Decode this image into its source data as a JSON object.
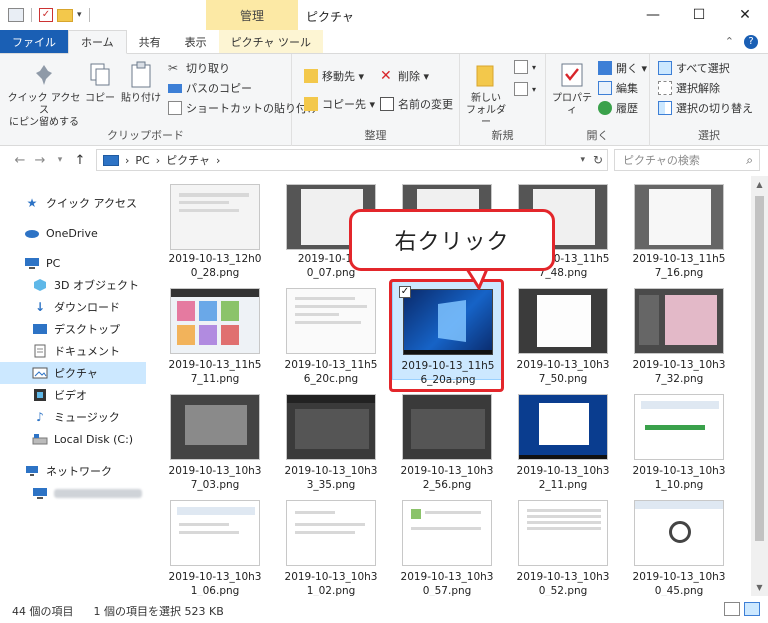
{
  "titlebar": {
    "manage_tab": "管理",
    "window_title": "ピクチャ",
    "minimize": "—",
    "maximize": "☐",
    "close": "✕"
  },
  "tabs": {
    "file": "ファイル",
    "home": "ホーム",
    "share": "共有",
    "view": "表示",
    "picture_tools": "ピクチャ ツール"
  },
  "ribbon": {
    "clipboard": {
      "label": "クリップボード",
      "pin_quick_access": "クイック アクセス\nにピン留めする",
      "pin_line1": "クイック アクセス",
      "pin_line2": "にピン留めする",
      "copy": "コピー",
      "paste": "貼り付け",
      "cut": "切り取り",
      "copy_path": "パスのコピー",
      "paste_shortcut": "ショートカットの貼り付け"
    },
    "organize": {
      "label": "整理",
      "move_to": "移動先 ▾",
      "copy_to": "コピー先 ▾",
      "delete": "削除 ▾",
      "rename": "名前の変更"
    },
    "new": {
      "label": "新規",
      "new_folder_line1": "新しい",
      "new_folder_line2": "フォルダー"
    },
    "open": {
      "label": "開く",
      "properties": "プロパティ",
      "open": "開く ▾",
      "edit": "編集",
      "history": "履歴"
    },
    "select": {
      "label": "選択",
      "select_all": "すべて選択",
      "select_none": "選択解除",
      "invert": "選択の切り替え"
    }
  },
  "address": {
    "path": [
      "PC",
      "ピクチャ"
    ],
    "separator": "›",
    "search_placeholder": "ピクチャの検索"
  },
  "nav": {
    "items": [
      {
        "label": "クイック アクセス",
        "icon": "star-icon"
      },
      {
        "label": "OneDrive",
        "icon": "cloud-icon"
      },
      {
        "label": "PC",
        "icon": "computer-icon"
      },
      {
        "label": "3D オブジェクト",
        "icon": "cube-icon"
      },
      {
        "label": "ダウンロード",
        "icon": "download-icon"
      },
      {
        "label": "デスクトップ",
        "icon": "desktop-icon"
      },
      {
        "label": "ドキュメント",
        "icon": "document-icon"
      },
      {
        "label": "ピクチャ",
        "icon": "picture-icon"
      },
      {
        "label": "ビデオ",
        "icon": "video-icon"
      },
      {
        "label": "ミュージック",
        "icon": "music-icon"
      },
      {
        "label": "Local Disk (C:)",
        "icon": "disk-icon"
      },
      {
        "label": "ネットワーク",
        "icon": "network-icon"
      }
    ]
  },
  "files": [
    {
      "line1": "2019-10-13_12h0",
      "line2": "0_28.png"
    },
    {
      "line1": "2019-10-13_",
      "line2": "0_07.png"
    },
    {
      "line1": "",
      "line2": ""
    },
    {
      "line1": "2019-10-13_11h5",
      "line2": "7_48.png"
    },
    {
      "line1": "2019-10-13_11h5",
      "line2": "7_16.png"
    },
    {
      "line1": "2019-10-13_11h5",
      "line2": "7_11.png"
    },
    {
      "line1": "2019-10-13_11h5",
      "line2": "6_20c.png"
    },
    {
      "line1": "2019-10-13_11h5",
      "line2": "6_20a.png"
    },
    {
      "line1": "2019-10-13_10h3",
      "line2": "7_50.png"
    },
    {
      "line1": "2019-10-13_10h3",
      "line2": "7_32.png"
    },
    {
      "line1": "2019-10-13_10h3",
      "line2": "7_03.png"
    },
    {
      "line1": "2019-10-13_10h3",
      "line2": "3_35.png"
    },
    {
      "line1": "2019-10-13_10h3",
      "line2": "2_56.png"
    },
    {
      "line1": "2019-10-13_10h3",
      "line2": "2_11.png"
    },
    {
      "line1": "2019-10-13_10h3",
      "line2": "1_10.png"
    },
    {
      "line1": "2019-10-13_10h3",
      "line2": "1_06.png"
    },
    {
      "line1": "2019-10-13_10h3",
      "line2": "1_02.png"
    },
    {
      "line1": "2019-10-13_10h3",
      "line2": "0_57.png"
    },
    {
      "line1": "2019-10-13_10h3",
      "line2": "0_52.png"
    },
    {
      "line1": "2019-10-13_10h3",
      "line2": "0_45.png"
    }
  ],
  "callout": {
    "text": "右クリック",
    "color": "#e3262b"
  },
  "status": {
    "item_count": "44 個の項目",
    "selection": "1 個の項目を選択  523 KB"
  },
  "colors": {
    "accent": "#1a5fb4",
    "selection": "#cce8ff",
    "manage_tab": "#fce9a5"
  }
}
